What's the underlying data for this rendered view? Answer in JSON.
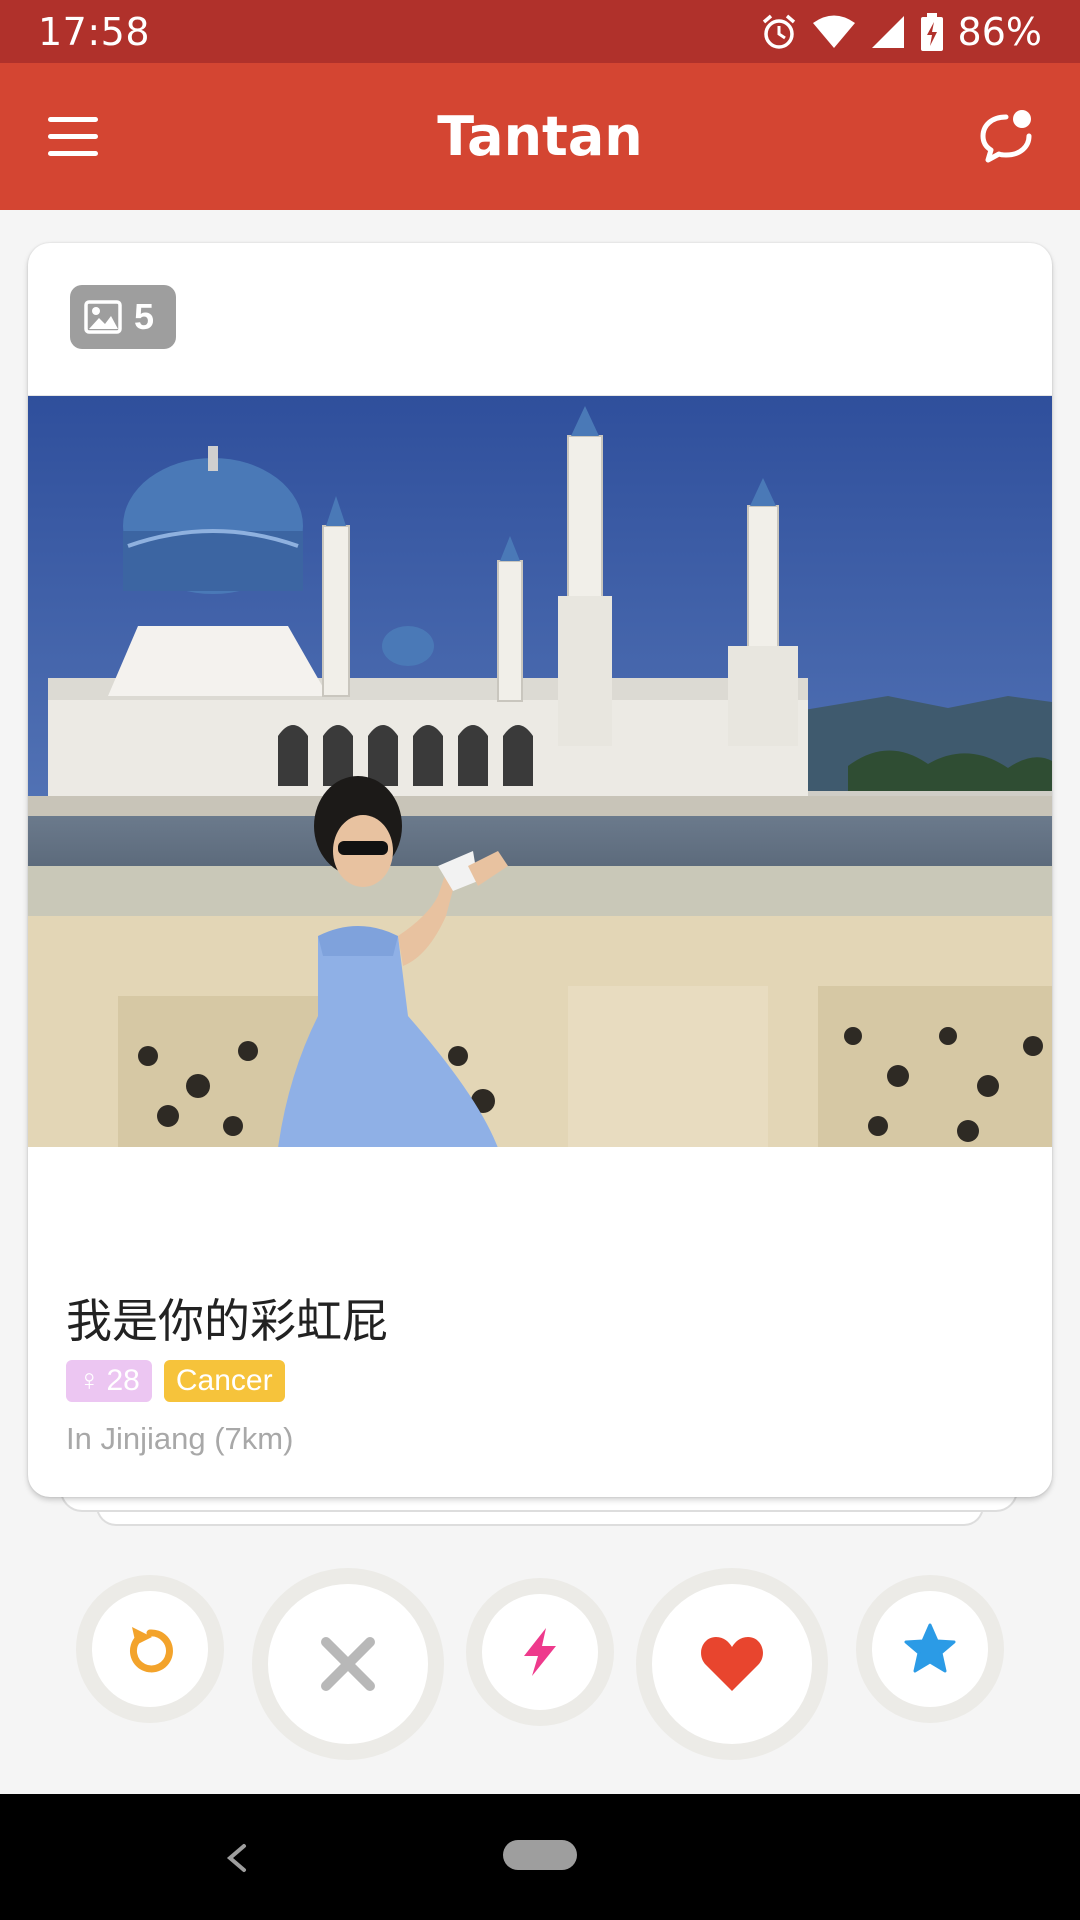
{
  "status_bar": {
    "time": "17:58",
    "battery_percent": "86%"
  },
  "app_bar": {
    "title": "Tantan"
  },
  "profile_card": {
    "photo_count": "5",
    "name": "我是你的彩虹屁",
    "age_tag": {
      "symbol": "♀",
      "age": "28"
    },
    "zodiac_tag": "Cancer",
    "location": "In Jinjiang (7km)"
  },
  "actions": [
    {
      "name": "undo",
      "icon": "undo-icon",
      "color": "#f3a32b"
    },
    {
      "name": "nope",
      "icon": "close-icon",
      "color": "#b8b8b8"
    },
    {
      "name": "boost",
      "icon": "lightning-icon",
      "color": "#ee3a8c"
    },
    {
      "name": "like",
      "icon": "heart-icon",
      "color": "#e8452e"
    },
    {
      "name": "super-like",
      "icon": "star-icon",
      "color": "#2b9be6"
    }
  ],
  "colors": {
    "status_bar": "#b0312b",
    "app_bar": "#d44532",
    "accent": "#d44532"
  }
}
